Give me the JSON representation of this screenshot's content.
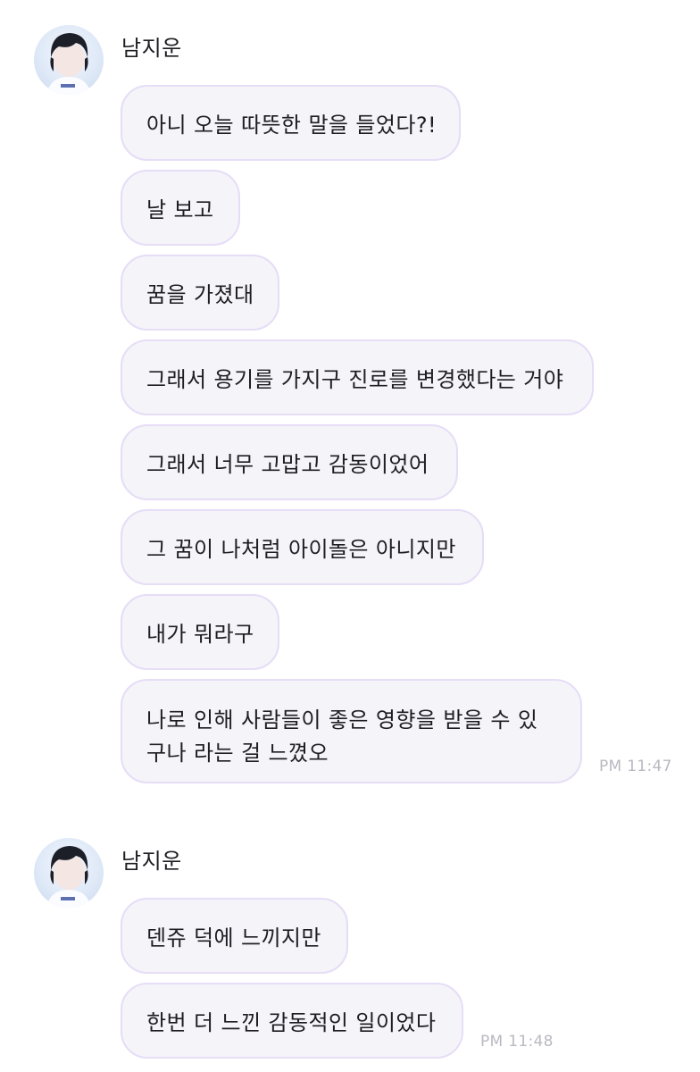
{
  "groups": [
    {
      "sender": "남지운",
      "messages": [
        "아니 오늘 따뜻한 말을 들었다?!",
        "날 보고",
        "꿈을 가졌대",
        "그래서 용기를 가지구 진로를 변경했다는 거야",
        "그래서 너무 고맙고 감동이었어",
        "그 꿈이 나처럼 아이돌은 아니지만",
        "내가 뭐라구",
        "나로 인해 사람들이 좋은 영향을 받을 수 있구나 라는 걸 느꼈오"
      ],
      "time": "PM 11:47"
    },
    {
      "sender": "남지운",
      "messages": [
        "덴쥬 덕에 느끼지만",
        "한번 더 느낀 감동적인 일이었다"
      ],
      "time": "PM 11:48"
    }
  ],
  "colors": {
    "bubble_bg": "#f4f4f9",
    "bubble_border": "#e6ddf6",
    "text": "#1d1d22",
    "time": "#b9b9c2"
  },
  "icons": {
    "avatar": "profile-photo-avatar"
  }
}
